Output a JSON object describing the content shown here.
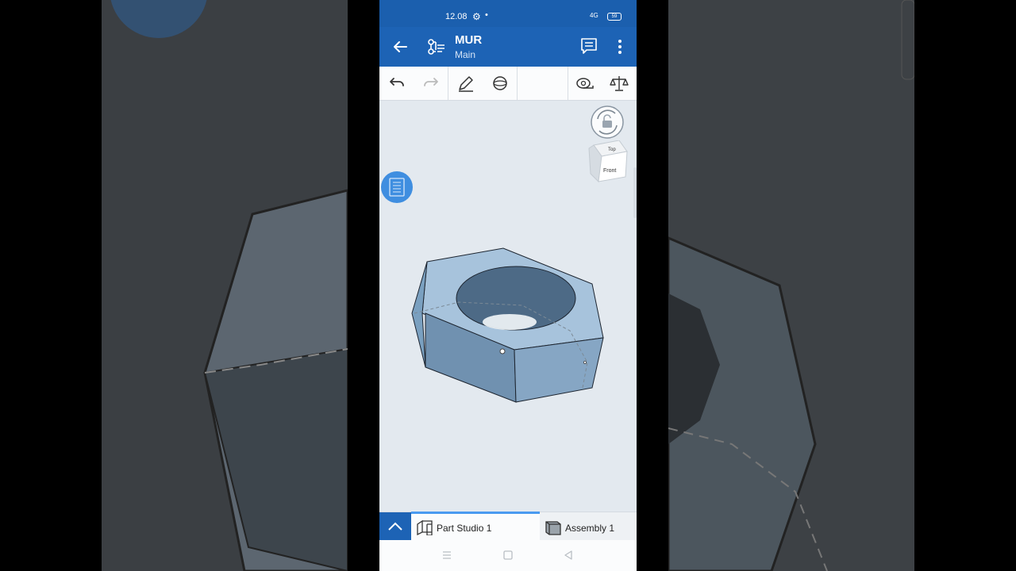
{
  "status_bar": {
    "time": "12.08",
    "signal": "4G",
    "battery": "59"
  },
  "app_bar": {
    "title": "MUR",
    "subtitle": "Main"
  },
  "tabs": [
    {
      "label": "Part Studio 1",
      "active": true
    },
    {
      "label": "Assembly 1",
      "active": false
    }
  ],
  "view_cube": {
    "top_label": "Top",
    "front_label": "Front"
  },
  "colors": {
    "primary": "#1d63b5",
    "accent": "#4a9af0",
    "part_face": "#8eb1cf",
    "background": "#e3e9ef"
  },
  "icons": {
    "back": "arrow-left-icon",
    "tree": "feature-tree-icon",
    "comment": "comment-icon",
    "more": "more-vert-icon",
    "undo": "undo-icon",
    "redo": "redo-icon",
    "sketch": "pencil-icon",
    "view": "sphere-icon",
    "measure": "tape-measure-icon",
    "mass": "scale-icon"
  }
}
